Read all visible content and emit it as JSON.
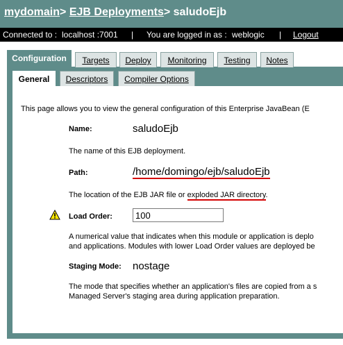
{
  "breadcrumb": {
    "domain": "mydomain",
    "sep1": ">",
    "deployments": "EJB Deployments",
    "sep2": ">",
    "current": "saludoEjb"
  },
  "status": {
    "connected_label": "Connected to :",
    "host": "localhost :7001",
    "divider": "|",
    "logged_in_label": "You are logged in as :",
    "user": "weblogic",
    "logout": "Logout"
  },
  "tabs": [
    "Configuration",
    "Targets",
    "Deploy",
    "Monitoring",
    "Testing",
    "Notes"
  ],
  "subtabs": [
    "General",
    "Descriptors",
    "Compiler Options"
  ],
  "intro_text": "This page allows you to view the general configuration of this Enterprise JavaBean (E",
  "fields": {
    "name": {
      "label": "Name:",
      "value": "saludoEjb",
      "desc": "The name of this EJB deployment."
    },
    "path": {
      "label": "Path:",
      "value": "/home/domingo/ejb/saludoEjb",
      "desc_prefix": "The location of the EJB JAR file or ",
      "desc_link": "exploded JAR directory",
      "desc_suffix": "."
    },
    "load_order": {
      "label": "Load Order:",
      "value": "100",
      "desc_line1": "A numerical value that indicates when this module or application is deplo",
      "desc_line2": "and applications. Modules with lower Load Order values are deployed be"
    },
    "staging_mode": {
      "label": "Staging Mode:",
      "value": "nostage",
      "desc_line1": "The mode that specifies whether an application's files are copied from a s",
      "desc_line2": "Managed Server's staging area during application preparation."
    }
  },
  "colors": {
    "teal": "#5f8c8a",
    "tab_bg": "#dde4e4",
    "highlight": "#d40000"
  }
}
